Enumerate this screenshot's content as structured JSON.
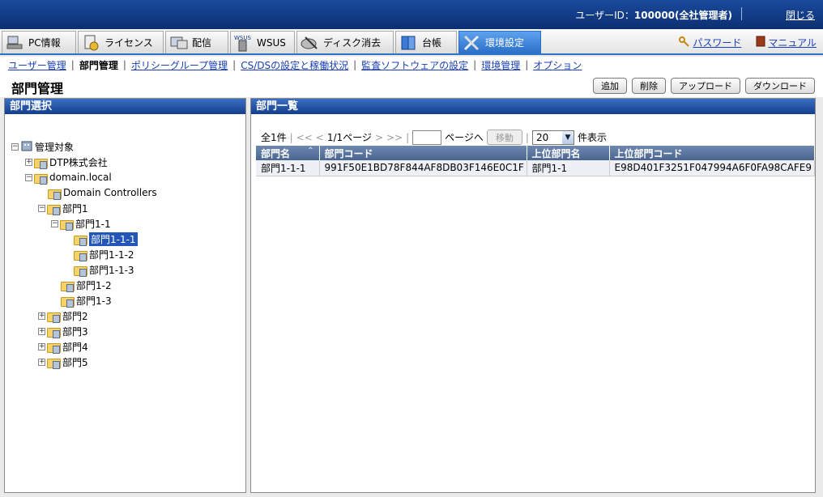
{
  "header": {
    "user_label": "ユーザーID：",
    "user_value": "100000(全社管理者)",
    "logout": "閉じる"
  },
  "tabs": [
    {
      "label": "PC情報",
      "icon": "pc-icon",
      "active": false
    },
    {
      "label": "ライセンス",
      "icon": "license-icon",
      "active": false
    },
    {
      "label": "配信",
      "icon": "distribution-icon",
      "active": false
    },
    {
      "label": "WSUS",
      "icon": "wsus-icon",
      "active": false
    },
    {
      "label": "ディスク消去",
      "icon": "disk-erase-icon",
      "active": false
    },
    {
      "label": "台帳",
      "icon": "ledger-icon",
      "active": false
    },
    {
      "label": "環境設定",
      "icon": "settings-tools-icon",
      "active": true
    }
  ],
  "right_links": {
    "password": "パスワード",
    "manual": "マニュアル"
  },
  "subnav": [
    {
      "label": "ユーザー管理",
      "current": false
    },
    {
      "label": "部門管理",
      "current": true
    },
    {
      "label": "ポリシーグループ管理",
      "current": false
    },
    {
      "label": "CS/DSの設定と稼働状況",
      "current": false
    },
    {
      "label": "監査ソフトウェアの設定",
      "current": false
    },
    {
      "label": "環境管理",
      "current": false
    },
    {
      "label": "オプション",
      "current": false
    }
  ],
  "page_title": "部門管理",
  "actions": {
    "add": "追加",
    "delete": "削除",
    "upload": "アップロード",
    "download": "ダウンロード"
  },
  "left_panel": {
    "title": "部門選択",
    "tree": [
      {
        "label": "管理対象",
        "toggle": "−",
        "root": true
      },
      {
        "label": "DTP株式会社",
        "toggle": "+"
      },
      {
        "label": "domain.local",
        "toggle": "−"
      },
      {
        "label": "Domain Controllers",
        "toggle": ""
      },
      {
        "label": "部門1",
        "toggle": "−"
      },
      {
        "label": "部門1-1",
        "toggle": "−"
      },
      {
        "label": "部門1-1-1",
        "toggle": "",
        "selected": true
      },
      {
        "label": "部門1-1-2",
        "toggle": ""
      },
      {
        "label": "部門1-1-3",
        "toggle": ""
      },
      {
        "label": "部門1-2",
        "toggle": ""
      },
      {
        "label": "部門1-3",
        "toggle": ""
      },
      {
        "label": "部門2",
        "toggle": "+"
      },
      {
        "label": "部門3",
        "toggle": "+"
      },
      {
        "label": "部門4",
        "toggle": "+"
      },
      {
        "label": "部門5",
        "toggle": "+"
      }
    ]
  },
  "right_panel": {
    "title": "部門一覧",
    "pager": {
      "total": "全1件",
      "first": "<<",
      "prev": "<",
      "page": "1/1ページ",
      "next": ">",
      "last": ">>",
      "goto_suffix": "ページへ",
      "move": "移動",
      "per_page": "20",
      "per_page_suffix": "件表示"
    },
    "columns": [
      "部門名",
      "部門コード",
      "上位部門名",
      "上位部門コード"
    ],
    "rows": [
      [
        "部門1-1-1",
        "991F50E1BD78F844AF8DB03F146E0C1F",
        "部門1-1",
        "E98D401F3251F047994A6F0FA98CAFE9"
      ]
    ]
  }
}
